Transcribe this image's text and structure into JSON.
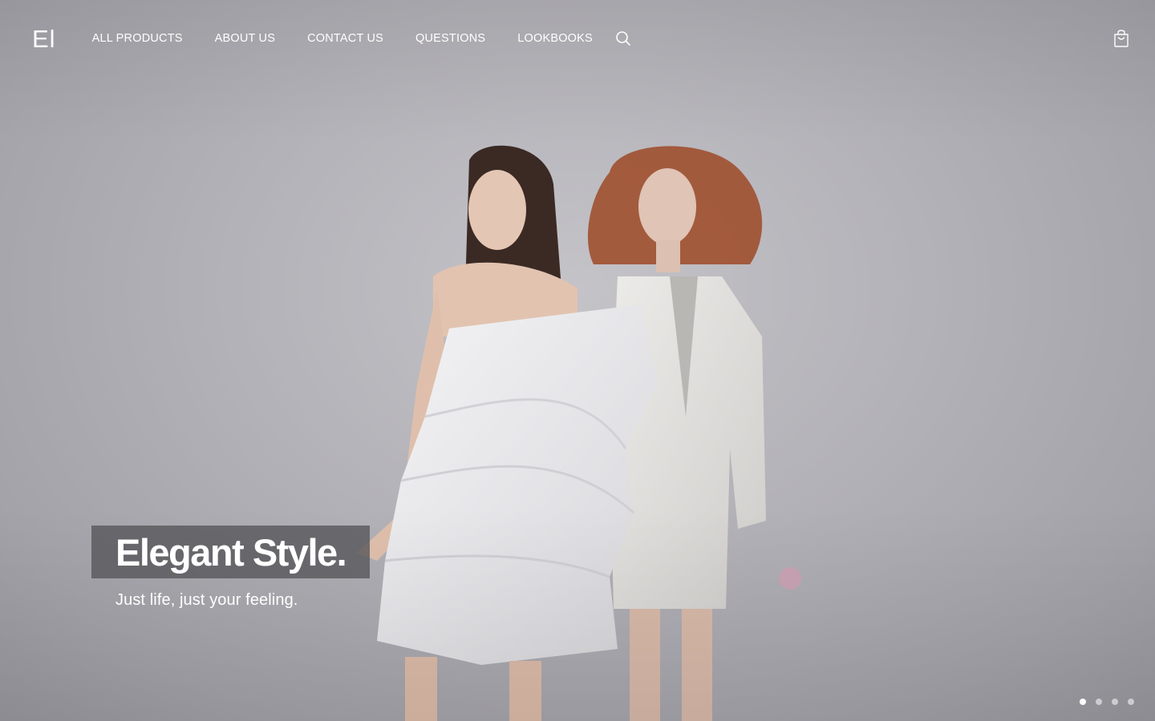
{
  "brand": {
    "logo_text": "El"
  },
  "nav": {
    "items": [
      {
        "label": "ALL PRODUCTS"
      },
      {
        "label": "ABOUT US"
      },
      {
        "label": "CONTACT US"
      },
      {
        "label": "QUESTIONS"
      },
      {
        "label": "LOOKBOOKS"
      }
    ],
    "search_icon": "search-icon",
    "cart_icon": "shopping-bag-icon"
  },
  "hero": {
    "headline": "Elegant Style.",
    "subheadline": "Just life, just your feeling.",
    "slides_total": 4,
    "active_slide": 1
  },
  "colors": {
    "background": "#b2b1b7",
    "text": "#ffffff",
    "headline_box": "#555558"
  }
}
